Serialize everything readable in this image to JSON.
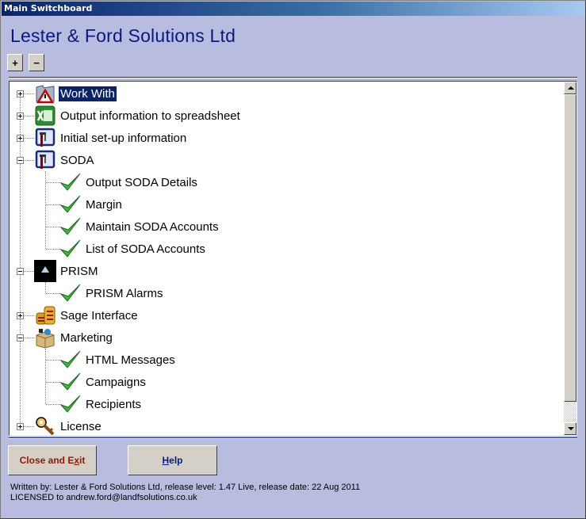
{
  "window": {
    "title": "Main Switchboard"
  },
  "header": {
    "company_name": "Lester & Ford Solutions Ltd"
  },
  "toolbar": {
    "expand_all_label": "+",
    "collapse_all_label": "−"
  },
  "tree": {
    "nodes": [
      {
        "label": "Work With",
        "level": 0,
        "state": "collapsed",
        "icon": "folder-warning-icon",
        "selected": true
      },
      {
        "label": "Output information to spreadsheet",
        "level": 0,
        "state": "collapsed",
        "icon": "excel-icon"
      },
      {
        "label": "Initial set-up information",
        "level": 0,
        "state": "collapsed",
        "icon": "setup-window-icon"
      },
      {
        "label": "SODA",
        "level": 0,
        "state": "expanded",
        "icon": "setup-window-icon"
      },
      {
        "label": "Output SODA Details",
        "level": 1,
        "icon": "checkmark-icon"
      },
      {
        "label": "Margin",
        "level": 1,
        "icon": "checkmark-icon"
      },
      {
        "label": "Maintain SODA Accounts",
        "level": 1,
        "icon": "checkmark-icon"
      },
      {
        "label": "List of SODA Accounts",
        "level": 1,
        "icon": "checkmark-icon"
      },
      {
        "label": "PRISM",
        "level": 0,
        "state": "expanded",
        "icon": "prism-icon"
      },
      {
        "label": "PRISM Alarms",
        "level": 1,
        "icon": "checkmark-icon"
      },
      {
        "label": "Sage Interface",
        "level": 0,
        "state": "collapsed",
        "icon": "coins-icon"
      },
      {
        "label": "Marketing",
        "level": 0,
        "state": "expanded",
        "icon": "box-icon"
      },
      {
        "label": "HTML Messages",
        "level": 1,
        "icon": "checkmark-icon"
      },
      {
        "label": "Campaigns",
        "level": 1,
        "icon": "checkmark-icon"
      },
      {
        "label": "Recipients",
        "level": 1,
        "icon": "checkmark-icon"
      },
      {
        "label": "License",
        "level": 0,
        "state": "collapsed",
        "icon": "key-icon"
      }
    ]
  },
  "buttons": {
    "close_exit": {
      "label_pre": "Close and E",
      "label_accel": "x",
      "label_post": "it"
    },
    "help": {
      "label_pre": "",
      "label_accel": "H",
      "label_post": "elp"
    }
  },
  "footer": {
    "release_line": "Written by: Lester & Ford Solutions Ltd, release level: 1.47 Live, release date: 22 Aug 2011",
    "license_line": "LICENSED to andrew.ford@landfsolutions.co.uk"
  },
  "colors": {
    "title_text": "#0a1a80",
    "close_button_text": "#8b1a00",
    "help_button_text": "#0a1a80",
    "selection": "#0a246a"
  }
}
